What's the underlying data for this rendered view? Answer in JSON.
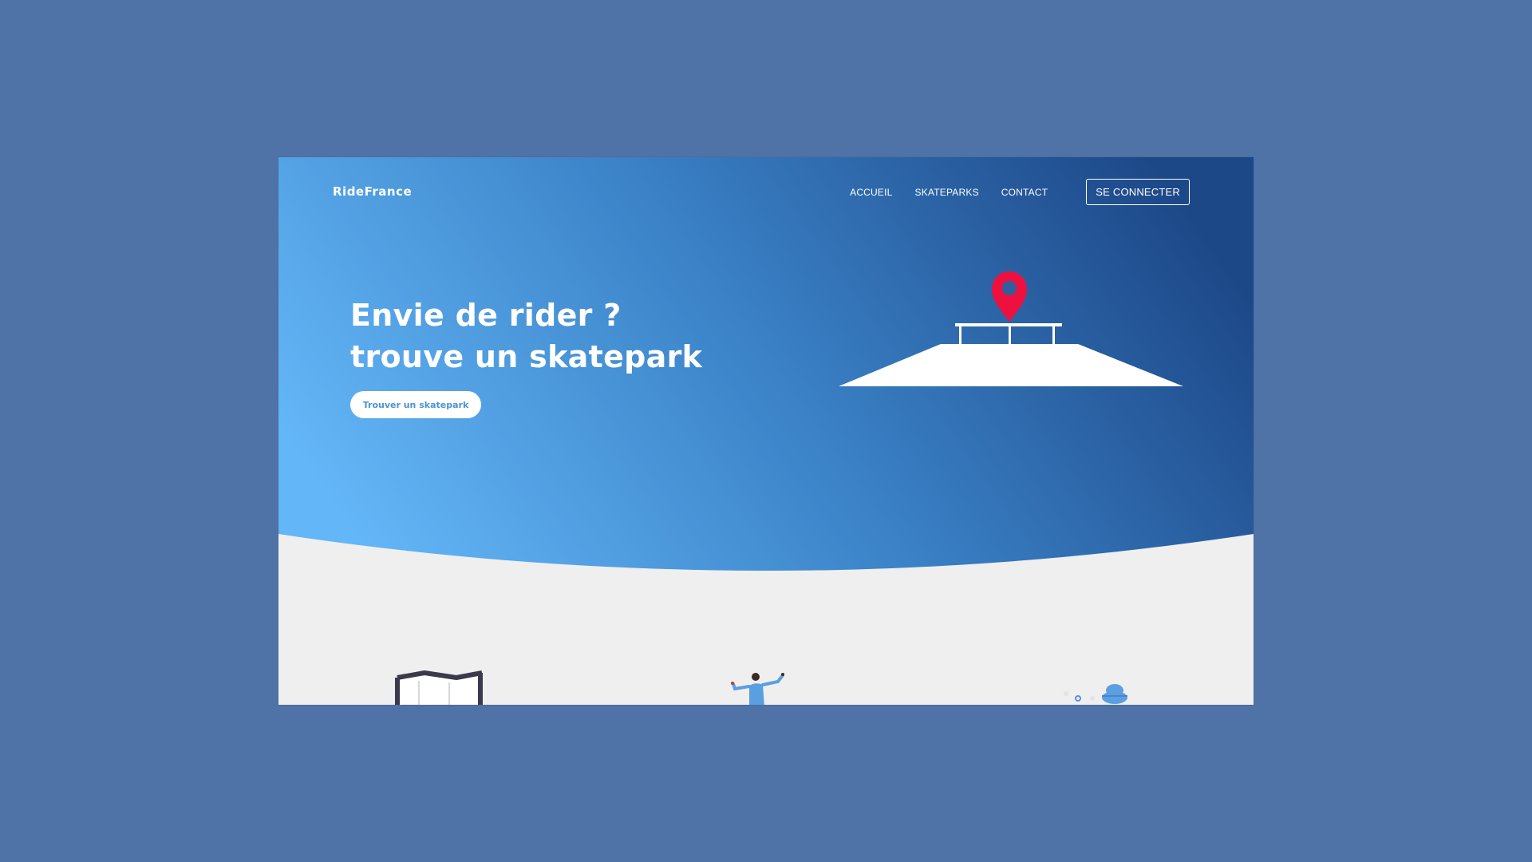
{
  "colors": {
    "page_bg": "#4f73a6",
    "gradient_start": "#63b6f7",
    "gradient_end": "#1d4888",
    "section_bg": "#efefef",
    "pin_red": "#ee1140",
    "cta_text": "#4a93d6"
  },
  "header": {
    "logo": "RideFrance",
    "nav": [
      "ACCUEIL",
      "SKATEPARKS",
      "CONTACT"
    ],
    "connect_label": "SE CONNECTER"
  },
  "hero": {
    "title_line1": "Envie de rider ?",
    "title_line2": "trouve un skatepark",
    "cta_label": "Trouver un skatepark",
    "illustration_icon": "map-pin-skate-ramp-icon"
  },
  "features": {
    "icons": [
      "map-icon",
      "skater-icon",
      "map-dots-icon"
    ]
  }
}
